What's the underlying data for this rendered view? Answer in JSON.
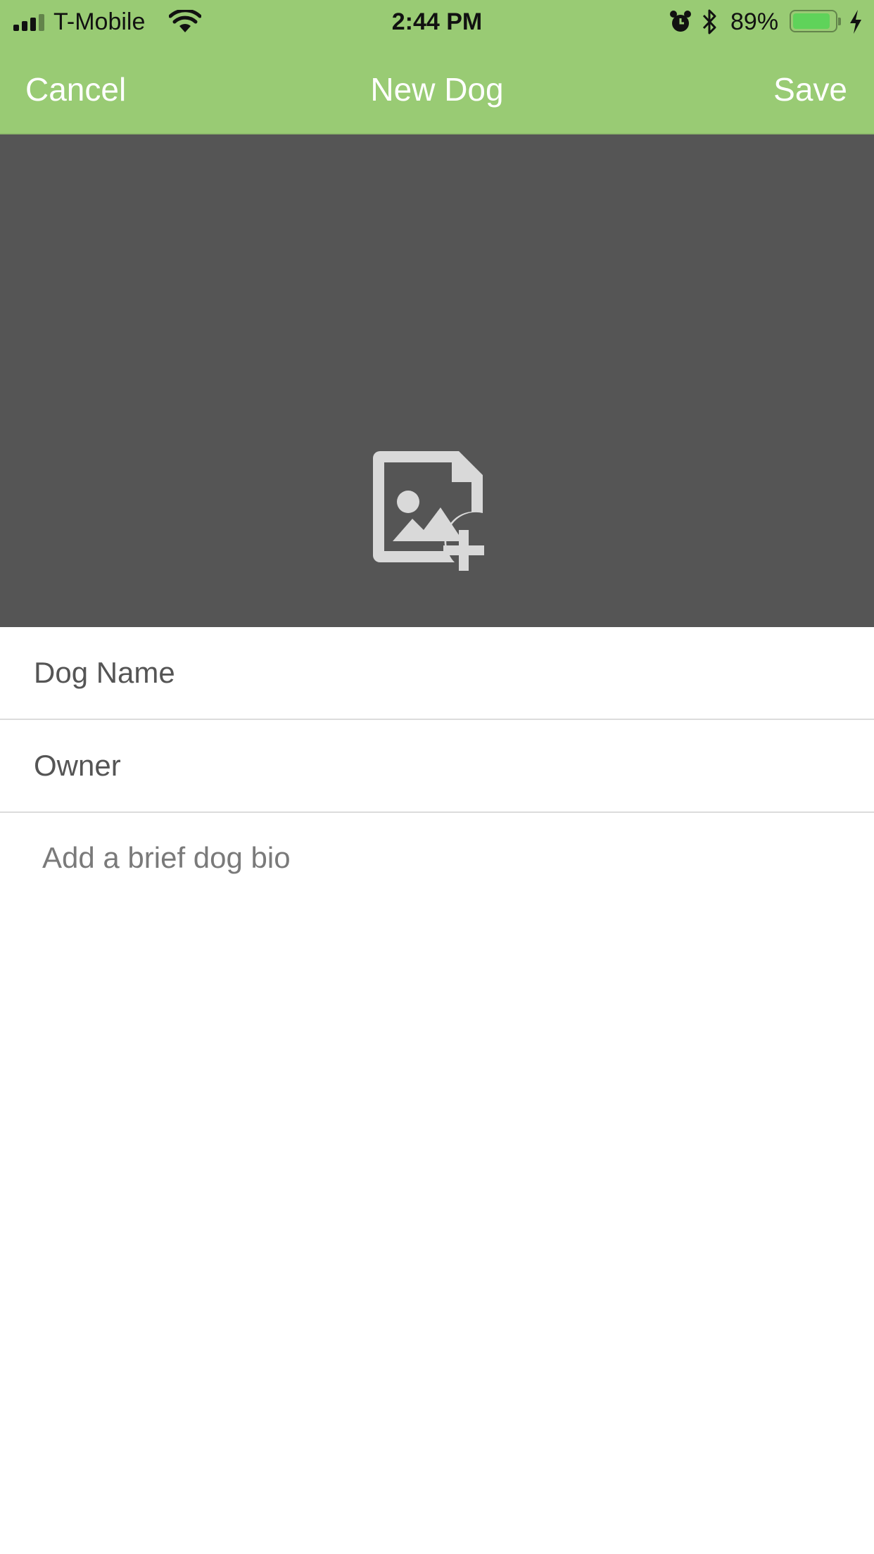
{
  "status_bar": {
    "carrier": "T-Mobile",
    "time": "2:44 PM",
    "battery_percent": "89%",
    "battery_level": 0.89,
    "icons": [
      "signal-icon",
      "wifi-icon",
      "alarm-icon",
      "bluetooth-icon",
      "battery-icon",
      "charging-icon"
    ]
  },
  "nav": {
    "cancel_label": "Cancel",
    "title": "New Dog",
    "save_label": "Save"
  },
  "photo": {
    "icon": "add-photo-icon",
    "background": "#555555"
  },
  "form": {
    "dog_name_placeholder": "Dog Name",
    "dog_name_value": "",
    "owner_placeholder": "Owner",
    "owner_value": "",
    "bio_placeholder": "Add a brief dog bio",
    "bio_value": ""
  },
  "colors": {
    "header": "#99cb74",
    "photo_area": "#555555",
    "battery_fill": "#5fd35a"
  }
}
